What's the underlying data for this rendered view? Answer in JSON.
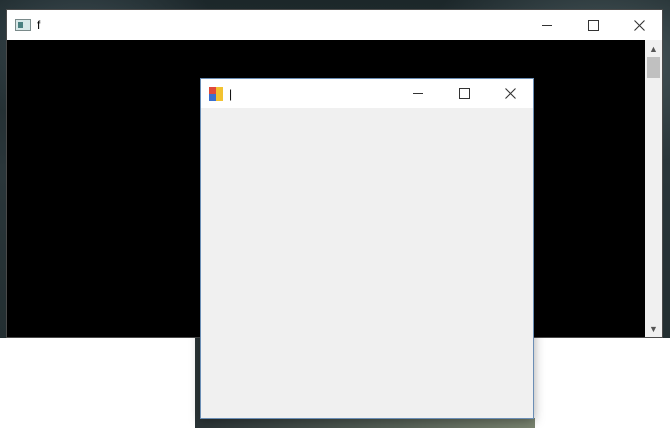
{
  "console_window": {
    "title": "f",
    "buttons": {
      "minimize": "minimize",
      "maximize": "maximize",
      "close": "close"
    },
    "scrollbar": {
      "up_arrow": "▲",
      "down_arrow": "▼"
    }
  },
  "form_window": {
    "title": "|",
    "buttons": {
      "minimize": "minimize",
      "maximize": "maximize",
      "close": "close"
    }
  },
  "icons": {
    "console_icon": "console-app-icon",
    "form_icon": "winforms-app-icon",
    "minimize": "minimize-icon",
    "maximize": "maximize-icon",
    "close": "close-icon"
  },
  "colors": {
    "console_background": "#000000",
    "titlebar": "#ffffff",
    "form_background": "#f0f0f0",
    "form_border": "#6b8eb5"
  }
}
